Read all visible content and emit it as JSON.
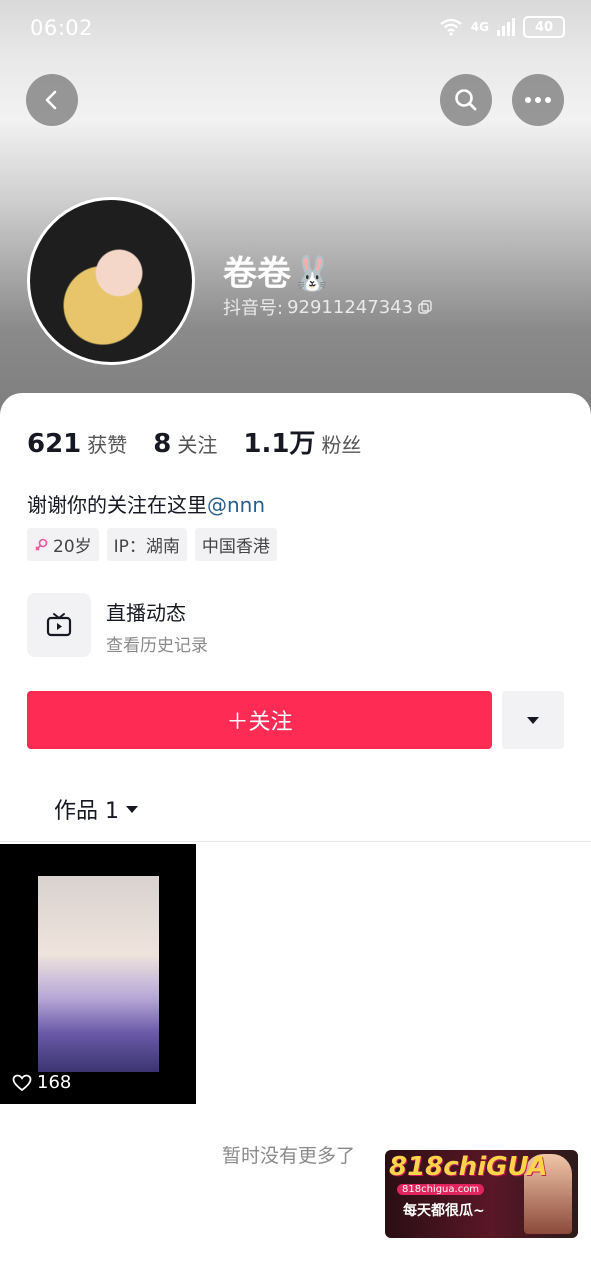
{
  "status_bar": {
    "time": "06:02",
    "network": "4G",
    "battery": "40"
  },
  "profile": {
    "name": "卷卷🐰",
    "douyin_id_label": "抖音号: ",
    "douyin_id": "92911247343"
  },
  "stats": [
    {
      "value": "621",
      "label": "获赞"
    },
    {
      "value": "8",
      "label": "关注"
    },
    {
      "value": "1.1万",
      "label": "粉丝"
    }
  ],
  "bio": {
    "text": "谢谢你的关注在这里",
    "mention": "@nnn"
  },
  "tags": {
    "age": "20岁",
    "ip": "IP：湖南",
    "location": "中国香港"
  },
  "live": {
    "title": "直播动态",
    "subtitle": "查看历史记录"
  },
  "actions": {
    "follow_label": "＋关注"
  },
  "works": {
    "tab_label": "作品 1"
  },
  "videos": [
    {
      "likes": "168"
    }
  ],
  "footer": {
    "no_more": "暂时没有更多了"
  },
  "ad": {
    "title": "818chiGUA",
    "url": "818chigua.com",
    "slogan": "每天都很瓜~"
  },
  "colors": {
    "accent": "#fe2c55",
    "mention": "#2a5d8a"
  }
}
